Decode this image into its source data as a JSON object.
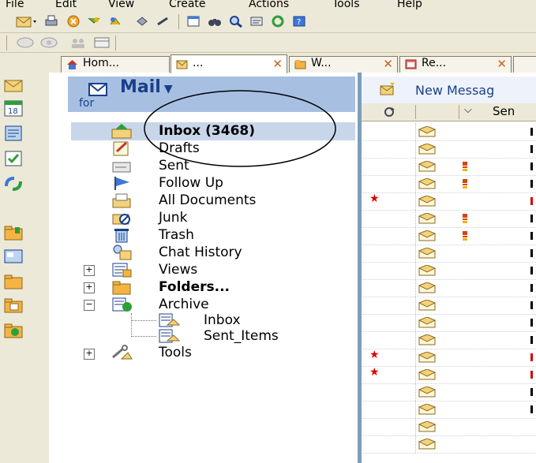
{
  "menu": [
    "File",
    "Edit",
    "View",
    "Create",
    "Actions",
    "Tools",
    "Help"
  ],
  "tabs": [
    {
      "label": "Hom...",
      "icon": "home-icon",
      "active": false
    },
    {
      "label": "...",
      "icon": "mail-icon",
      "active": true
    },
    {
      "label": "W...",
      "icon": "folder-icon",
      "active": false
    },
    {
      "label": "Re...",
      "icon": "calendar-icon",
      "active": false
    }
  ],
  "mail": {
    "title": "Mail",
    "for": "for",
    "folders": [
      {
        "label": "Inbox (3468)",
        "bold": true,
        "icon": "inbox-icon"
      },
      {
        "label": "Drafts",
        "bold": false,
        "icon": "drafts-icon"
      },
      {
        "label": "Sent",
        "bold": false,
        "icon": "sent-icon"
      },
      {
        "label": "Follow Up",
        "bold": false,
        "icon": "follow-up-flag-icon"
      },
      {
        "label": "All Documents",
        "bold": false,
        "icon": "all-documents-icon"
      },
      {
        "label": "Junk",
        "bold": false,
        "icon": "junk-icon"
      },
      {
        "label": "Trash",
        "bold": false,
        "icon": "trash-icon"
      },
      {
        "label": "Chat History",
        "bold": false,
        "icon": "chat-history-icon"
      },
      {
        "label": "Views",
        "bold": false,
        "icon": "views-icon",
        "expander": "+"
      },
      {
        "label": "Folders...",
        "bold": true,
        "icon": "folders-icon",
        "expander": "+"
      },
      {
        "label": "Archive",
        "bold": false,
        "icon": "archive-icon",
        "expander": "-"
      },
      {
        "label": "Inbox",
        "bold": false,
        "icon": "archive-inbox-icon",
        "child": true
      },
      {
        "label": "Sent_Items",
        "bold": false,
        "icon": "archive-sent-icon",
        "child": true
      },
      {
        "label": "Tools",
        "bold": false,
        "icon": "tools-icon",
        "expander": "+"
      }
    ]
  },
  "right": {
    "new_message": "New Messag",
    "column_label": "Sen"
  },
  "colors": {
    "accent": "#1a3f8a",
    "panel_header": "#a7c0e2",
    "star": "#e00000",
    "chrome": "#ece9d8"
  }
}
